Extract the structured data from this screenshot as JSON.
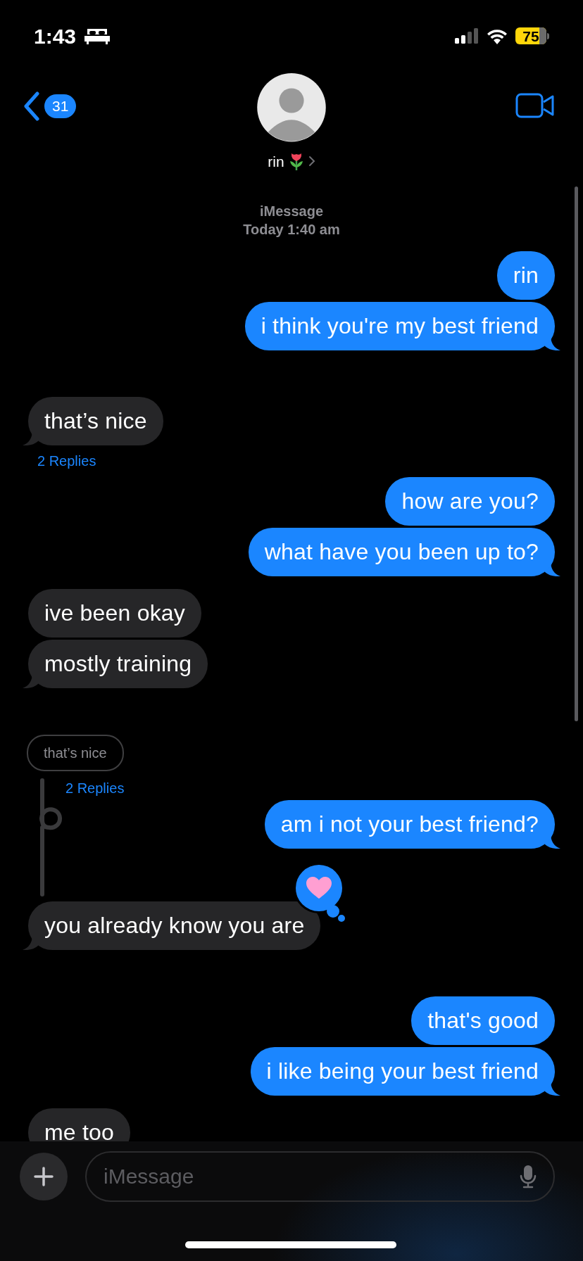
{
  "status_bar": {
    "time": "1:43",
    "battery": "75"
  },
  "header": {
    "back_count": "31",
    "contact_name": "rin"
  },
  "thread_info": {
    "service": "iMessage",
    "timestamp": "Today 1:40 am"
  },
  "messages": [
    {
      "kind": "sent",
      "text": "rin",
      "tail": false
    },
    {
      "kind": "sent",
      "text": "i think you're my best friend",
      "tail": true
    },
    {
      "kind": "received",
      "text": "that’s nice",
      "tail": true,
      "gap_before": true
    },
    {
      "kind": "replies",
      "text": "2 Replies",
      "thread": false
    },
    {
      "kind": "sent",
      "text": "how are you?",
      "tail": false
    },
    {
      "kind": "sent",
      "text": "what have you been up to?",
      "tail": true
    },
    {
      "kind": "received",
      "text": "ive been okay",
      "tail": false
    },
    {
      "kind": "received",
      "text": "mostly training",
      "tail": true
    },
    {
      "kind": "quote",
      "text": "that’s nice",
      "gap_before": true
    },
    {
      "kind": "replies",
      "text": "2 Replies",
      "thread": true
    },
    {
      "kind": "sent",
      "text": "am i not your best friend?",
      "tail": true
    },
    {
      "kind": "received",
      "text": "you already know you are",
      "tail": true,
      "reacted": true
    },
    {
      "kind": "sent",
      "text": "that's good",
      "tail": false,
      "gap_before": true
    },
    {
      "kind": "sent",
      "text": "i like being your best friend",
      "tail": true
    },
    {
      "kind": "received",
      "text": "me too",
      "tail": false
    }
  ],
  "composer": {
    "placeholder": "iMessage"
  }
}
